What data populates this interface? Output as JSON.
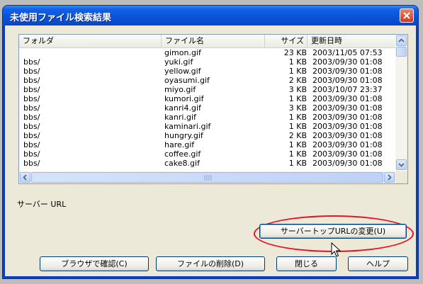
{
  "window": {
    "title": "未使用ファイル検索結果",
    "close_icon": "close-icon"
  },
  "list": {
    "columns": [
      "フォルダ",
      "ファイル名",
      "サイズ",
      "更新日時"
    ],
    "rows": [
      {
        "folder": "",
        "file": "gimon.gif",
        "size": "23 KB",
        "date": "2003/11/05 07:53"
      },
      {
        "folder": "bbs/",
        "file": "yuki.gif",
        "size": "1 KB",
        "date": "2003/09/30 01:08"
      },
      {
        "folder": "bbs/",
        "file": "yellow.gif",
        "size": "1 KB",
        "date": "2003/09/30 01:08"
      },
      {
        "folder": "bbs/",
        "file": "oyasumi.gif",
        "size": "2 KB",
        "date": "2003/09/30 01:08"
      },
      {
        "folder": "bbs/",
        "file": "miyo.gif",
        "size": "3 KB",
        "date": "2003/10/07 23:37"
      },
      {
        "folder": "bbs/",
        "file": "kumori.gif",
        "size": "1 KB",
        "date": "2003/09/30 01:08"
      },
      {
        "folder": "bbs/",
        "file": "kanri4.gif",
        "size": "3 KB",
        "date": "2003/09/30 01:08"
      },
      {
        "folder": "bbs/",
        "file": "kanri.gif",
        "size": "1 KB",
        "date": "2003/09/30 01:08"
      },
      {
        "folder": "bbs/",
        "file": "kaminari.gif",
        "size": "1 KB",
        "date": "2003/09/30 01:08"
      },
      {
        "folder": "bbs/",
        "file": "hungry.gif",
        "size": "2 KB",
        "date": "2003/09/30 01:08"
      },
      {
        "folder": "bbs/",
        "file": "hare.gif",
        "size": "1 KB",
        "date": "2003/09/30 01:08"
      },
      {
        "folder": "bbs/",
        "file": "coffee.gif",
        "size": "1 KB",
        "date": "2003/09/30 01:08"
      },
      {
        "folder": "bbs/",
        "file": "cake8.gif",
        "size": "1 KB",
        "date": "2003/09/30 01:08"
      }
    ]
  },
  "server_url_label": "サーバー URL",
  "buttons": {
    "change_url": "サーバートップURLの変更(U)",
    "browser": "ブラウザで確認(C)",
    "delete": "ファイルの削除(D)",
    "close": "閉じる",
    "help": "ヘルプ"
  },
  "colors": {
    "titlebar": "#0a52d8",
    "highlight_oval": "#e8141d",
    "dialog_bg": "#ece9d8"
  }
}
